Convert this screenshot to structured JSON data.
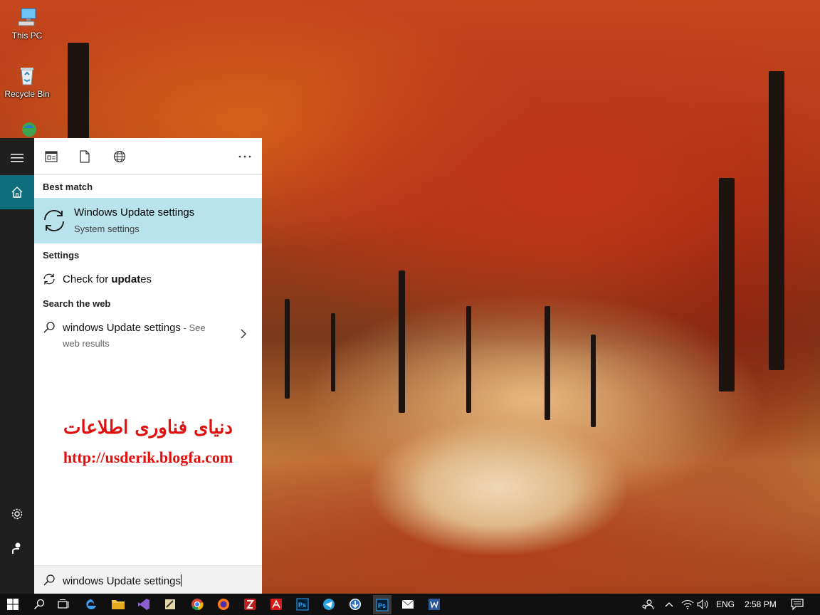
{
  "desktop": {
    "icons": [
      {
        "label": "This PC"
      },
      {
        "label": "Recycle Bin"
      }
    ]
  },
  "start_menu": {
    "rail": [
      "hamburger-icon",
      "home-icon",
      "gear-icon",
      "user-icon"
    ],
    "filters": [
      "apps-filter-icon",
      "documents-filter-icon",
      "web-filter-icon",
      "more-options-icon"
    ],
    "best_match": {
      "heading": "Best match",
      "title": "Windows Update settings",
      "subtitle": "System settings"
    },
    "settings": {
      "heading": "Settings",
      "item_prefix": "Check for ",
      "item_bold": "updat",
      "item_suffix": "es"
    },
    "web": {
      "heading": "Search the web",
      "query": "windows Update settings",
      "hint_line1": " - See",
      "hint_line2": "web results"
    },
    "watermark": {
      "line1": "دنیای فناوری اطلاعات",
      "line2": "http://usderik.blogfa.com"
    },
    "search": {
      "value": "windows Update settings"
    }
  },
  "taskbar": {
    "apps": [
      "windows-start-icon",
      "search-icon",
      "task-view-icon",
      "edge-icon",
      "file-explorer-icon",
      "visual-studio-icon",
      "app-icon",
      "chrome-icon",
      "firefox-icon",
      "filezilla-icon",
      "acrobat-icon",
      "photoshop-icon",
      "telegram-icon",
      "download-manager-icon",
      "photoshop-icon",
      "mail-icon",
      "word-icon"
    ],
    "language": "ENG",
    "time": "2:58 PM"
  },
  "colors": {
    "accent": "#0e6d7c",
    "best_match_bg": "#b8e3ea",
    "watermark": "#e0100f"
  }
}
